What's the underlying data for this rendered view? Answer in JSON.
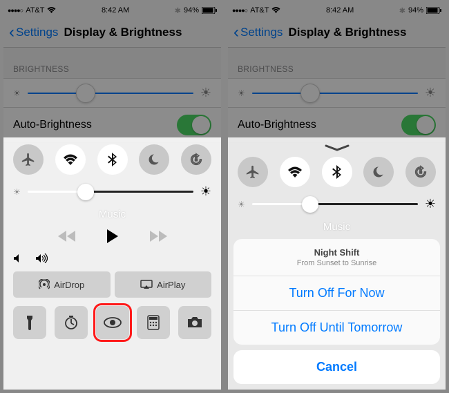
{
  "carrier": "AT&T",
  "time": "8:42 AM",
  "battery": "94%",
  "back_label": "Settings",
  "page_title": "Display & Brightness",
  "brightness_section": "BRIGHTNESS",
  "auto_brightness_label": "Auto-Brightness",
  "music_label": "Music",
  "airdrop_label": "AirDrop",
  "airplay_label": "AirPlay",
  "night_shift": {
    "title": "Night Shift",
    "subtitle": "From Sunset to Sunrise",
    "option1": "Turn Off For Now",
    "option2": "Turn Off Until Tomorrow",
    "cancel": "Cancel"
  }
}
